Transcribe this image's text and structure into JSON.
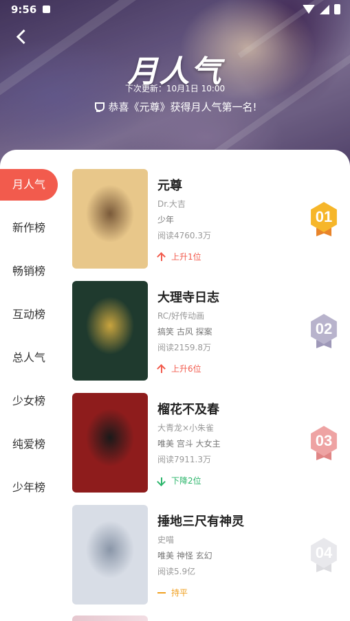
{
  "status_bar": {
    "time": "9:56"
  },
  "banner": {
    "title": "月人气",
    "update_text": "下次更新：10月1日 10:00",
    "congrats": "恭喜《元尊》获得月人气第一名!"
  },
  "sidebar": {
    "items": [
      {
        "label": "月人气",
        "active": true
      },
      {
        "label": "新作榜"
      },
      {
        "label": "畅销榜"
      },
      {
        "label": "互动榜"
      },
      {
        "label": "总人气"
      },
      {
        "label": "少女榜"
      },
      {
        "label": "纯爱榜"
      },
      {
        "label": "少年榜"
      }
    ]
  },
  "rankings": [
    {
      "rank": "01",
      "title": "元尊",
      "author": "Dr.大吉",
      "tags": "少年",
      "reads": "阅读4760.3万",
      "trend": "上升1位",
      "trend_type": "up",
      "badge_color": "#f6b62a",
      "ribbon_color": "#e8842a",
      "cover_colors": [
        "#e8c78a",
        "#7a5a3a",
        "#3a2a22"
      ]
    },
    {
      "rank": "02",
      "title": "大理寺日志",
      "author": "RC/好传动画",
      "tags": "搞笑 古风 探案",
      "reads": "阅读2159.8万",
      "trend": "上升6位",
      "trend_type": "up",
      "badge_color": "#b8b3cc",
      "ribbon_color": "#9e98b8",
      "cover_colors": [
        "#1f3a2e",
        "#c9a43e",
        "#0e2219"
      ]
    },
    {
      "rank": "03",
      "title": "榴花不及春",
      "author": "大青龙×小朱雀",
      "tags": "唯美 宫斗 大女主",
      "reads": "阅读7911.3万",
      "trend": "下降2位",
      "trend_type": "down",
      "badge_color": "#eea3a3",
      "ribbon_color": "#e08585",
      "cover_colors": [
        "#8e1c1c",
        "#1a1a1a",
        "#c23b2b"
      ]
    },
    {
      "rank": "04",
      "title": "捶地三尺有神灵",
      "author": "史喵",
      "tags": "唯美 神怪 玄幻",
      "reads": "阅读5.9亿",
      "trend": "持平",
      "trend_type": "flat",
      "badge_color": "#e8e8ec",
      "ribbon_color": "#dcdce0",
      "cover_colors": [
        "#d8dde6",
        "#8a96a8",
        "#f2f2f4"
      ]
    }
  ]
}
